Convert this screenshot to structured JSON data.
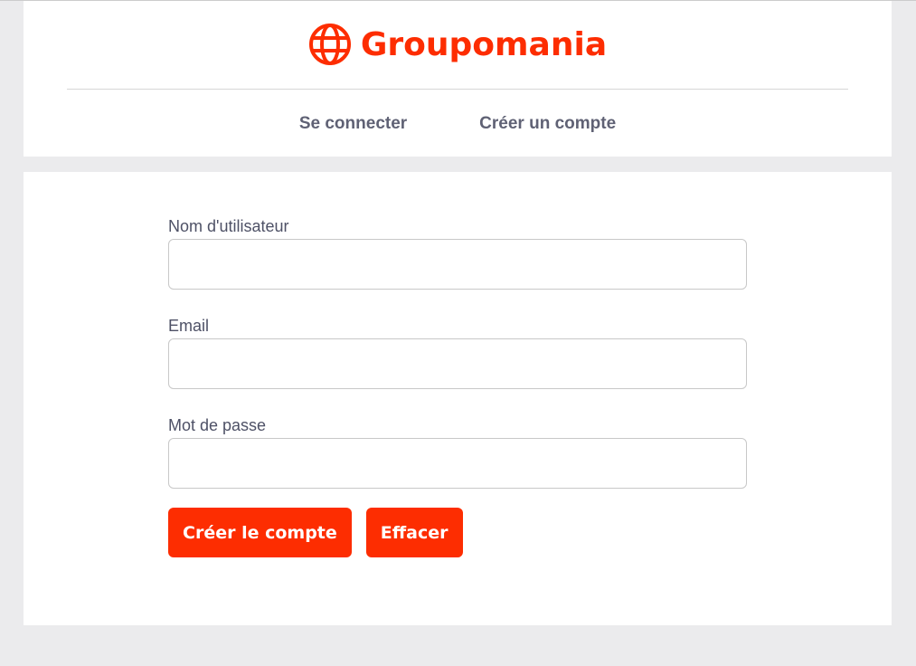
{
  "header": {
    "brand": "Groupomania",
    "nav": [
      "Se connecter",
      "Créer un compte"
    ]
  },
  "form": {
    "username_label": "Nom d'utilisateur",
    "email_label": "Email",
    "password_label": "Mot de passe",
    "submit": "Créer le compte",
    "clear": "Effacer"
  },
  "colors": {
    "accent": "#fd2d01",
    "text": "#4e5166"
  }
}
